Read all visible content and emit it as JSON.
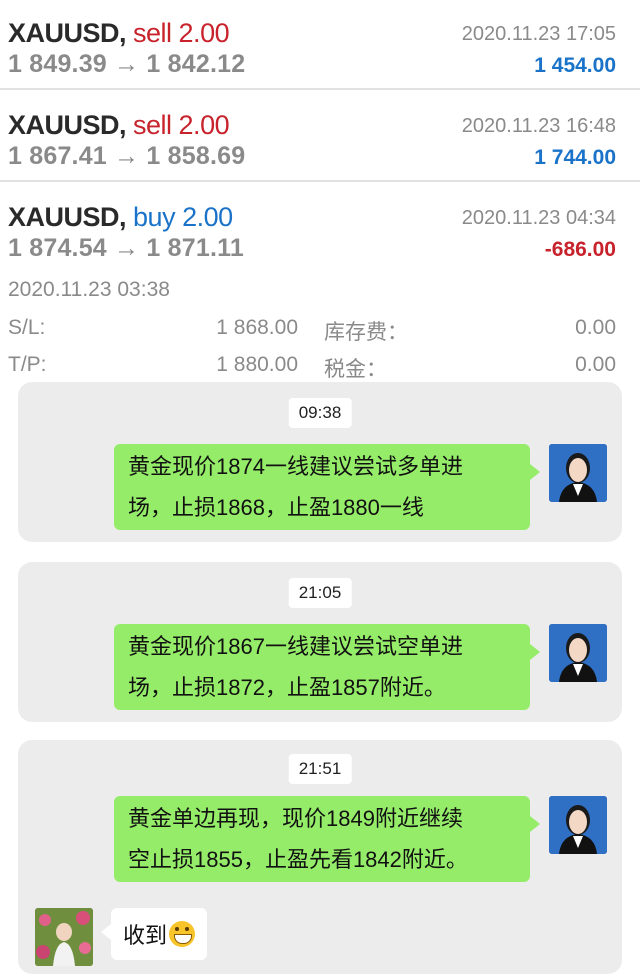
{
  "trades": [
    {
      "symbol": "XAUUSD,",
      "side": "sell 2.00",
      "prices": "1 849.39 → 1 842.12",
      "time": "2020.11.23 17:05",
      "profit": "1 454.00"
    },
    {
      "symbol": "XAUUSD,",
      "side": "sell 2.00",
      "prices": "1 867.41 → 1 858.69",
      "time": "2020.11.23 16:48",
      "profit": "1 744.00"
    },
    {
      "symbol": "XAUUSD,",
      "side": "buy 2.00",
      "prices": "1 874.54 → 1 871.11",
      "time": "2020.11.23 04:34",
      "profit": "-686.00"
    }
  ],
  "detail": {
    "open_time": "2020.11.23 03:38",
    "sl_label": "S/L:",
    "sl_value": "1 868.00",
    "swap_label": "库存费：",
    "swap_value": "0.00",
    "tp_label": "T/P:",
    "tp_value": "1 880.00",
    "tax_label": "税金：",
    "tax_value": "0.00"
  },
  "chat": [
    {
      "time": "09:38",
      "line1": "黄金现价1874一线建议尝试多单进",
      "line2": "场，止损1868，止盈1880一线"
    },
    {
      "time": "21:05",
      "line1": "黄金现价1867一线建议尝试空单进",
      "line2": "场，止损1872，止盈1857附近。"
    },
    {
      "time": "21:51",
      "line1": "黄金单边再现，现价1849附近继续",
      "line2": "空止损1855，止盈先看1842附近。"
    }
  ],
  "reply": {
    "text": "收到",
    "emoji": "grinning-face-emoji"
  },
  "colors": {
    "sell": "#c8232c",
    "buy": "#1a73c8",
    "bubble": "#95ec69",
    "card": "#ececec"
  }
}
